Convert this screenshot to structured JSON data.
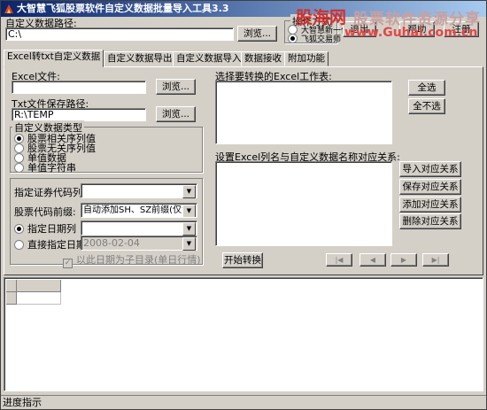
{
  "window": {
    "title": "大智慧飞狐股票软件自定义数据批量导入工具3.3"
  },
  "toolbar": {
    "path_label": "自定义数据路径:",
    "path_value": "C:\\",
    "browse_label": "浏览...",
    "mode_group_label": "操作方式",
    "mode_options": [
      "大智慧新一代",
      "飞狐交易师"
    ],
    "help_label": "帮助",
    "register_label": "注册",
    "exit_label": "退出"
  },
  "watermark": {
    "brand": "股票软件资源分享",
    "url": "www.Guhai.com.cn",
    "logo": "股海网"
  },
  "tabs": [
    "Excel转txt自定义数据",
    "自定义数据导出",
    "自定义数据导入",
    "数据接收",
    "附加功能"
  ],
  "left": {
    "excel_file_label": "Excel文件:",
    "excel_file_value": "",
    "browse1": "浏览...",
    "txt_path_label": "Txt文件保存路径:",
    "txt_path_value": "R:\\TEMP",
    "browse2": "浏览...",
    "type_group_label": "自定义数据类型",
    "type_options": [
      "股票相关序列值",
      "股票无关序列值",
      "单值数据",
      "单值字符串"
    ],
    "code_col_label": "指定证券代码列:",
    "prefix_label": "股票代码前缀:",
    "prefix_value": "自动添加SH、SZ前缀(仅沪深",
    "date_col_label": "指定日期列",
    "direct_date_label": "直接指定日期",
    "direct_date_value": "2008-02-04",
    "subdir_label": "以此日期为子目录(单日行情)"
  },
  "right": {
    "worksheet_label": "选择要转换的Excel工作表:",
    "select_all": "全选",
    "deselect_all": "全不选",
    "mapping_label": "设置Excel列名与自定义数据名称对应关系:",
    "import_map": "导入对应关系",
    "save_map": "保存对应关系",
    "add_map": "添加对应关系",
    "delete_map": "删除对应关系",
    "start_convert": "开始转换",
    "nav": [
      "|◀",
      "◀",
      "▶",
      "▶|"
    ]
  },
  "status": {
    "text": "进度指示"
  }
}
